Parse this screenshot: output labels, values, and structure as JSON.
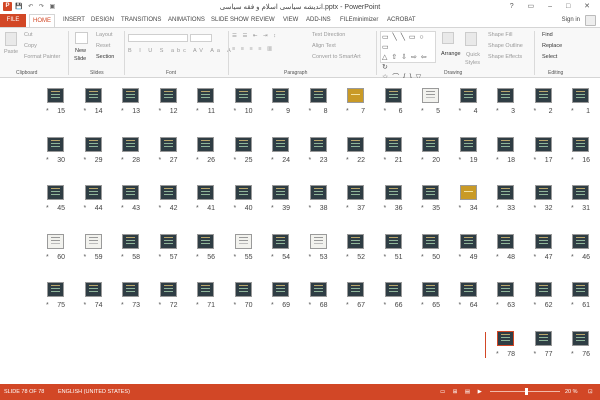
{
  "window": {
    "title": "اندیشه سیاسی اسلام و فقه سیاسی.pptx - PowerPoint",
    "app_icon": "P",
    "qat_icons": [
      "save-icon",
      "undo-icon",
      "redo-icon",
      "slideshow-icon"
    ],
    "controls": [
      "?",
      "▭",
      "–",
      "□",
      "✕"
    ]
  },
  "tabs": [
    "FILE",
    "HOME",
    "INSERT",
    "DESIGN",
    "TRANSITIONS",
    "ANIMATIONS",
    "SLIDE SHOW",
    "REVIEW",
    "VIEW",
    "ADD-INS",
    "FILEminimizer",
    "ACROBAT"
  ],
  "active_tab": "HOME",
  "sign_in": "Sign in",
  "ribbon": {
    "clipboard": {
      "paste": "Paste",
      "cut": "Cut",
      "copy": "Copy",
      "format_painter": "Format Painter",
      "label": "Clipboard"
    },
    "slides": {
      "new_slide": "New",
      "new_slide_2": "Slide",
      "layout": "Layout",
      "reset": "Reset",
      "section": "Section",
      "label": "Slides"
    },
    "font": {
      "label": "Font"
    },
    "paragraph": {
      "text_direction": "Text Direction",
      "align_text": "Align Text",
      "convert": "Convert to SmartArt",
      "label": "Paragraph"
    },
    "drawing": {
      "arrange": "Arrange",
      "quick_styles": "Quick",
      "quick_styles_2": "Styles",
      "shape_fill": "Shape Fill",
      "shape_outline": "Shape Outline",
      "shape_effects": "Shape Effects",
      "label": "Drawing"
    },
    "editing": {
      "find": "Find",
      "replace": "Replace",
      "select": "Select",
      "label": "Editing"
    }
  },
  "slides": [
    1,
    2,
    3,
    4,
    5,
    6,
    7,
    8,
    9,
    10,
    11,
    12,
    13,
    14,
    15,
    16,
    17,
    18,
    19,
    20,
    21,
    22,
    23,
    24,
    25,
    26,
    27,
    28,
    29,
    30,
    31,
    32,
    33,
    34,
    35,
    36,
    37,
    38,
    39,
    40,
    41,
    42,
    43,
    44,
    45,
    46,
    47,
    48,
    49,
    50,
    51,
    52,
    53,
    54,
    55,
    56,
    57,
    58,
    59,
    60,
    61,
    62,
    63,
    64,
    65,
    66,
    67,
    68,
    69,
    70,
    71,
    72,
    73,
    74,
    75,
    76,
    77,
    78
  ],
  "slide_star": "*",
  "selected_slide": 78,
  "status": {
    "slide_counter": "SLIDE 78 OF 78",
    "language": "ENGLISH (UNITED STATES)",
    "zoom": "20 %",
    "zoom_level": 0.2
  }
}
